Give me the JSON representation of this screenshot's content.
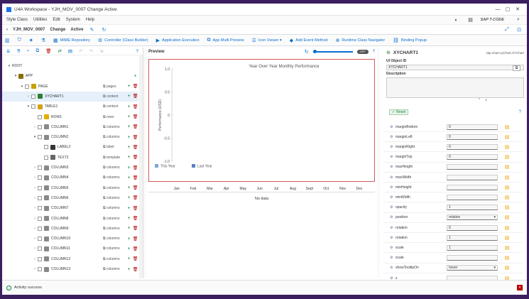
{
  "window": {
    "title": "U4A Workspace - YJH_MOV_0007 Change Active",
    "minimize": "—",
    "maximize": "▢",
    "close": "✕"
  },
  "menu": {
    "items": [
      "Style Class",
      "Utilities",
      "Edit",
      "System",
      "Help"
    ],
    "brand": "SAP T-CODE"
  },
  "header": {
    "back": "‹",
    "app_name": "YJH_MOV_0007",
    "mode": "Change",
    "status": "Active"
  },
  "toolbar": [
    {
      "label": "MIME Repository",
      "icon": "mime-icon"
    },
    {
      "label": "Controller (Class Builder)",
      "icon": "controller-icon"
    },
    {
      "label": "Application Execution",
      "icon": "run-icon"
    },
    {
      "label": "App Multi Preview",
      "icon": "preview-icon"
    },
    {
      "label": "Icon Viewer ▾",
      "icon": "icon-viewer-icon"
    },
    {
      "label": "Add Event Method",
      "icon": "event-icon"
    },
    {
      "label": "Runtime Class Navigator",
      "icon": "navigator-icon"
    },
    {
      "label": "Binding Popup",
      "icon": "binding-icon"
    }
  ],
  "tree": {
    "nodes": [
      {
        "label": "ROOT",
        "agg": "",
        "depth": 0,
        "exp": "▾",
        "cb": false,
        "icon": "",
        "color": ""
      },
      {
        "label": "APP",
        "agg": "",
        "depth": 1,
        "exp": "▾",
        "cb": false,
        "icon": "app-icon",
        "color": "#8a6d00"
      },
      {
        "label": "PAGE",
        "agg": "pages",
        "depth": 2,
        "exp": "▾",
        "cb": true,
        "icon": "page-icon",
        "color": "#c8a000"
      },
      {
        "label": "XYCHART1",
        "agg": "content",
        "depth": 3,
        "exp": "›",
        "cb": true,
        "icon": "chart-icon",
        "color": "#2e7d32",
        "selected": true
      },
      {
        "label": "TABLE1",
        "agg": "content",
        "depth": 3,
        "exp": "▾",
        "cb": true,
        "icon": "table-icon",
        "color": "#d4a017"
      },
      {
        "label": "ROW1",
        "agg": "rows",
        "depth": 4,
        "exp": "",
        "cb": true,
        "icon": "row-icon",
        "color": "#e0b000"
      },
      {
        "label": "COLUMN1",
        "agg": "columns",
        "depth": 4,
        "exp": "›",
        "cb": true,
        "icon": "column-icon",
        "color": "#888"
      },
      {
        "label": "COLUMN2",
        "agg": "columns",
        "depth": 4,
        "exp": "▾",
        "cb": true,
        "icon": "column-icon",
        "color": "#888"
      },
      {
        "label": "LABEL2",
        "agg": "label",
        "depth": 5,
        "exp": "",
        "cb": true,
        "icon": "label-icon",
        "color": "#333"
      },
      {
        "label": "TEXT2",
        "agg": "template",
        "depth": 5,
        "exp": "",
        "cb": true,
        "icon": "text-icon",
        "color": "#666"
      },
      {
        "label": "COLUMN3",
        "agg": "columns",
        "depth": 4,
        "exp": "›",
        "cb": true,
        "icon": "column-icon",
        "color": "#888"
      },
      {
        "label": "COLUMN4",
        "agg": "columns",
        "depth": 4,
        "exp": "›",
        "cb": true,
        "icon": "column-icon",
        "color": "#888"
      },
      {
        "label": "COLUMN5",
        "agg": "columns",
        "depth": 4,
        "exp": "›",
        "cb": true,
        "icon": "column-icon",
        "color": "#888"
      },
      {
        "label": "COLUMN6",
        "agg": "columns",
        "depth": 4,
        "exp": "›",
        "cb": true,
        "icon": "column-icon",
        "color": "#888"
      },
      {
        "label": "COLUMN7",
        "agg": "columns",
        "depth": 4,
        "exp": "›",
        "cb": true,
        "icon": "column-icon",
        "color": "#888"
      },
      {
        "label": "COLUMN8",
        "agg": "columns",
        "depth": 4,
        "exp": "›",
        "cb": true,
        "icon": "column-icon",
        "color": "#888"
      },
      {
        "label": "COLUMN9",
        "agg": "columns",
        "depth": 4,
        "exp": "›",
        "cb": true,
        "icon": "column-icon",
        "color": "#888"
      },
      {
        "label": "COLUMN10",
        "agg": "columns",
        "depth": 4,
        "exp": "›",
        "cb": true,
        "icon": "column-icon",
        "color": "#888"
      },
      {
        "label": "COLUMN11",
        "agg": "columns",
        "depth": 4,
        "exp": "›",
        "cb": true,
        "icon": "column-icon",
        "color": "#888"
      },
      {
        "label": "COLUMN12",
        "agg": "columns",
        "depth": 4,
        "exp": "›",
        "cb": true,
        "icon": "column-icon",
        "color": "#888"
      },
      {
        "label": "COLUMN13",
        "agg": "columns",
        "depth": 4,
        "exp": "›",
        "cb": true,
        "icon": "column-icon",
        "color": "#888"
      }
    ]
  },
  "preview": {
    "label": "Preview",
    "toggle": "OFF",
    "no_data": "No data"
  },
  "chart_data": {
    "type": "line",
    "title": "Year Over Year Monthly Performance",
    "xlabel": "",
    "ylabel": "Performance (USD)",
    "yticks": [
      "1.0",
      "0.5",
      "0",
      "-0.5",
      "-1.0"
    ],
    "ylim": [
      -1.0,
      1.0
    ],
    "categories": [
      "Jan",
      "Feb",
      "Mar",
      "Apr",
      "May",
      "Jun",
      "Jul",
      "Aug",
      "Sept",
      "Oct",
      "Nov",
      "Dec"
    ],
    "series": [
      {
        "name": "This Year",
        "values": [],
        "color": "#7ea6d8"
      },
      {
        "name": "Last Year",
        "values": [],
        "color": "#5b7fc4"
      }
    ]
  },
  "right": {
    "name": "XYCHART1",
    "class": "sap.chart.xyChart.XYChart",
    "id_label": "UI Object ID",
    "id_value": "XYCHART1",
    "desc_label": "Description",
    "reset": "Reset",
    "props": [
      {
        "name": "marginBottom",
        "value": "0",
        "kind": "text"
      },
      {
        "name": "marginLeft",
        "value": "0",
        "kind": "text"
      },
      {
        "name": "marginRight",
        "value": "0",
        "kind": "text"
      },
      {
        "name": "marginTop",
        "value": "0",
        "kind": "text"
      },
      {
        "name": "maxHeight",
        "value": "",
        "kind": "text"
      },
      {
        "name": "maxWidth",
        "value": "",
        "kind": "text"
      },
      {
        "name": "minHeight",
        "value": "",
        "kind": "text"
      },
      {
        "name": "minWidth",
        "value": "",
        "kind": "text"
      },
      {
        "name": "opacity",
        "value": "1",
        "kind": "text"
      },
      {
        "name": "position",
        "value": "relative",
        "kind": "select"
      },
      {
        "name": "rotation",
        "value": "0",
        "kind": "text"
      },
      {
        "name": "rotation",
        "value": "1",
        "kind": "text"
      },
      {
        "name": "scale",
        "value": "1",
        "kind": "text"
      },
      {
        "name": "scale",
        "value": "",
        "kind": "text"
      },
      {
        "name": "showTooltipOn",
        "value": "hover",
        "kind": "select"
      },
      {
        "name": "x",
        "value": "",
        "kind": "text"
      }
    ]
  },
  "status": {
    "text": "Activity success"
  }
}
